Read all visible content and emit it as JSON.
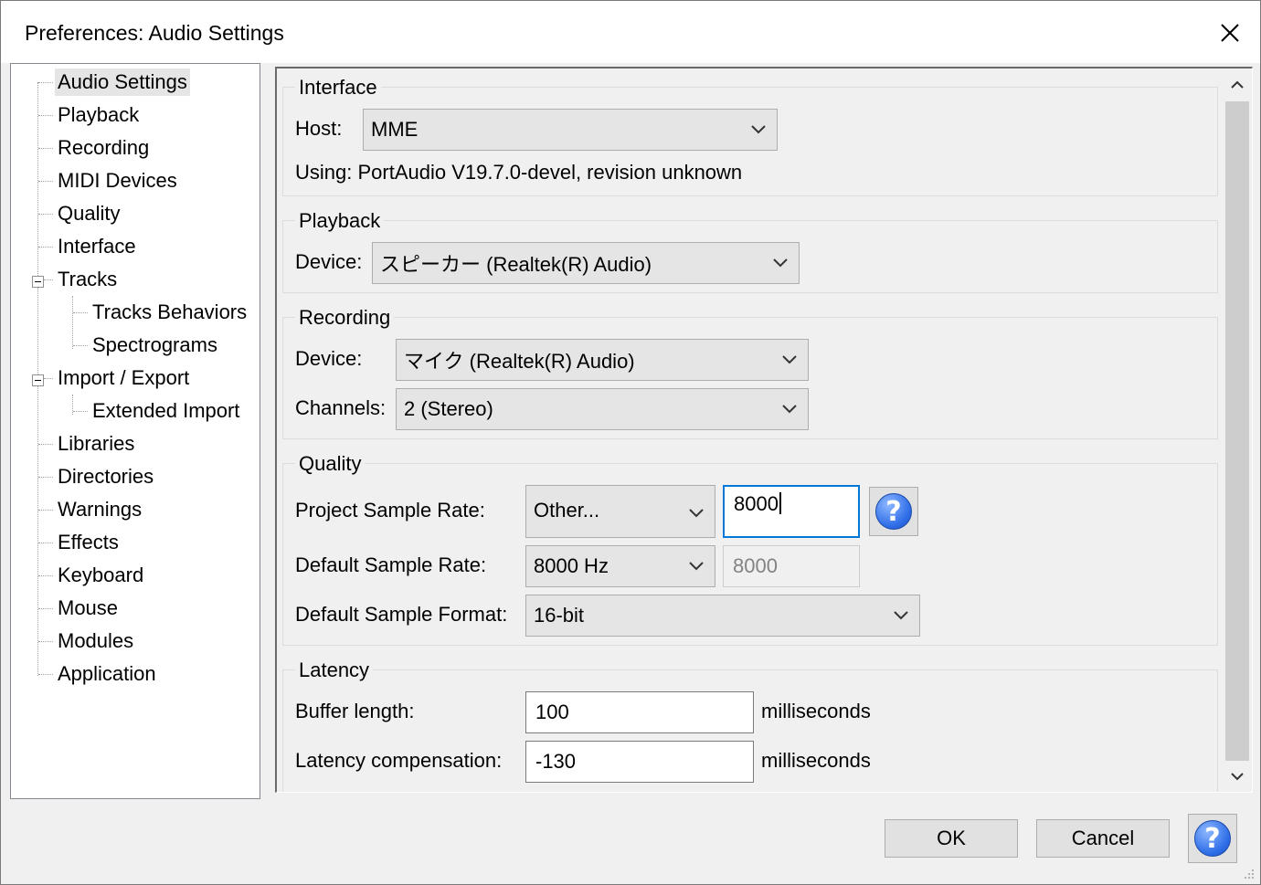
{
  "window": {
    "title": "Preferences: Audio Settings"
  },
  "tree": {
    "items": [
      {
        "label": "Audio Settings"
      },
      {
        "label": "Playback"
      },
      {
        "label": "Recording"
      },
      {
        "label": "MIDI Devices"
      },
      {
        "label": "Quality"
      },
      {
        "label": "Interface"
      },
      {
        "label": "Tracks"
      },
      {
        "label": "Tracks Behaviors"
      },
      {
        "label": "Spectrograms"
      },
      {
        "label": "Import / Export"
      },
      {
        "label": "Extended Import"
      },
      {
        "label": "Libraries"
      },
      {
        "label": "Directories"
      },
      {
        "label": "Warnings"
      },
      {
        "label": "Effects"
      },
      {
        "label": "Keyboard"
      },
      {
        "label": "Mouse"
      },
      {
        "label": "Modules"
      },
      {
        "label": "Application"
      }
    ],
    "selected": "Audio Settings"
  },
  "interface": {
    "title": "Interface",
    "host_label": "Host:",
    "host_value": "MME",
    "using_text": "Using: PortAudio V19.7.0-devel, revision unknown"
  },
  "playback": {
    "title": "Playback",
    "device_label": "Device:",
    "device_value": "スピーカー (Realtek(R) Audio)"
  },
  "recording": {
    "title": "Recording",
    "device_label": "Device:",
    "device_value": "マイク (Realtek(R) Audio)",
    "channels_label": "Channels:",
    "channels_value": "2 (Stereo)"
  },
  "quality": {
    "title": "Quality",
    "project_rate_label": "Project Sample Rate:",
    "project_rate_value": "Other...",
    "project_rate_custom": "8000",
    "default_rate_label": "Default Sample Rate:",
    "default_rate_value": "8000 Hz",
    "default_rate_custom": "8000",
    "format_label": "Default Sample Format:",
    "format_value": "16-bit"
  },
  "latency": {
    "title": "Latency",
    "buffer_label": "Buffer length:",
    "buffer_value": "100",
    "buffer_unit": "milliseconds",
    "comp_label": "Latency compensation:",
    "comp_value": "-130",
    "comp_unit": "milliseconds"
  },
  "buttons": {
    "ok": "OK",
    "cancel": "Cancel",
    "help": "?"
  },
  "colors": {
    "accent": "#0078d7",
    "help_blue": "#2f6ee8"
  }
}
